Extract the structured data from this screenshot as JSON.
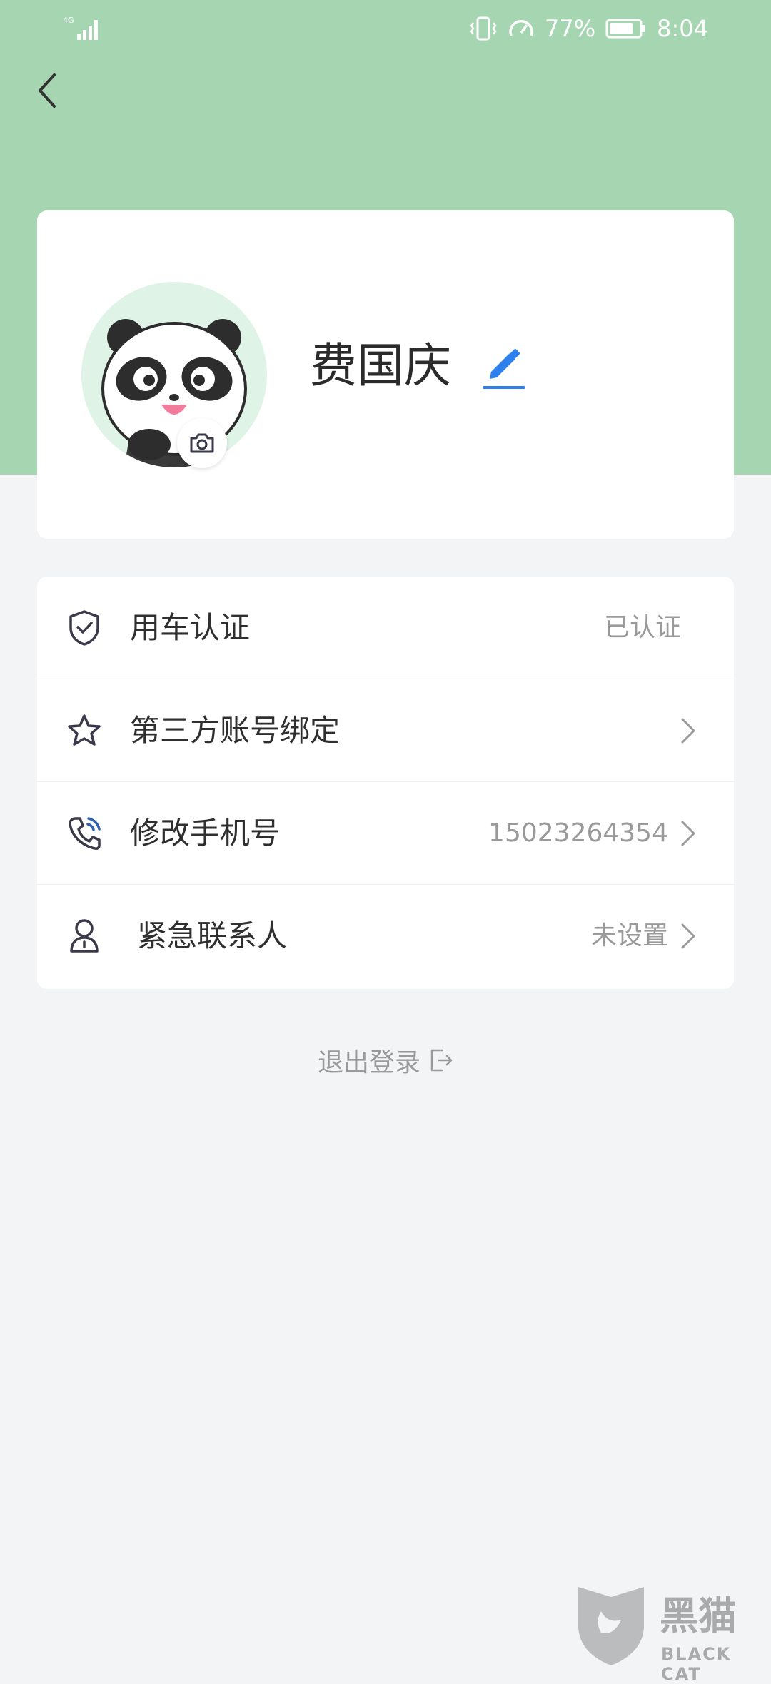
{
  "status_bar": {
    "network": "4G",
    "battery": "77%",
    "time": "8:04"
  },
  "profile": {
    "name": "费国庆"
  },
  "menu": [
    {
      "label": "用车认证",
      "value": "已认证",
      "icon": "shield-check-icon",
      "chevron": false
    },
    {
      "label": "第三方账号绑定",
      "value": "",
      "icon": "star-icon",
      "chevron": true
    },
    {
      "label": "修改手机号",
      "value": "15023264354",
      "icon": "phone-icon",
      "chevron": true
    },
    {
      "label": "紧急联系人",
      "value": "未设置",
      "icon": "contact-person-icon",
      "chevron": true
    }
  ],
  "logout": {
    "label": "退出登录"
  },
  "watermark": {
    "title": "黑猫",
    "subtitle": "BLACK CAT"
  },
  "colors": {
    "header": "#a5d5b1",
    "accent": "#2f80ed",
    "background": "#f3f4f6"
  }
}
